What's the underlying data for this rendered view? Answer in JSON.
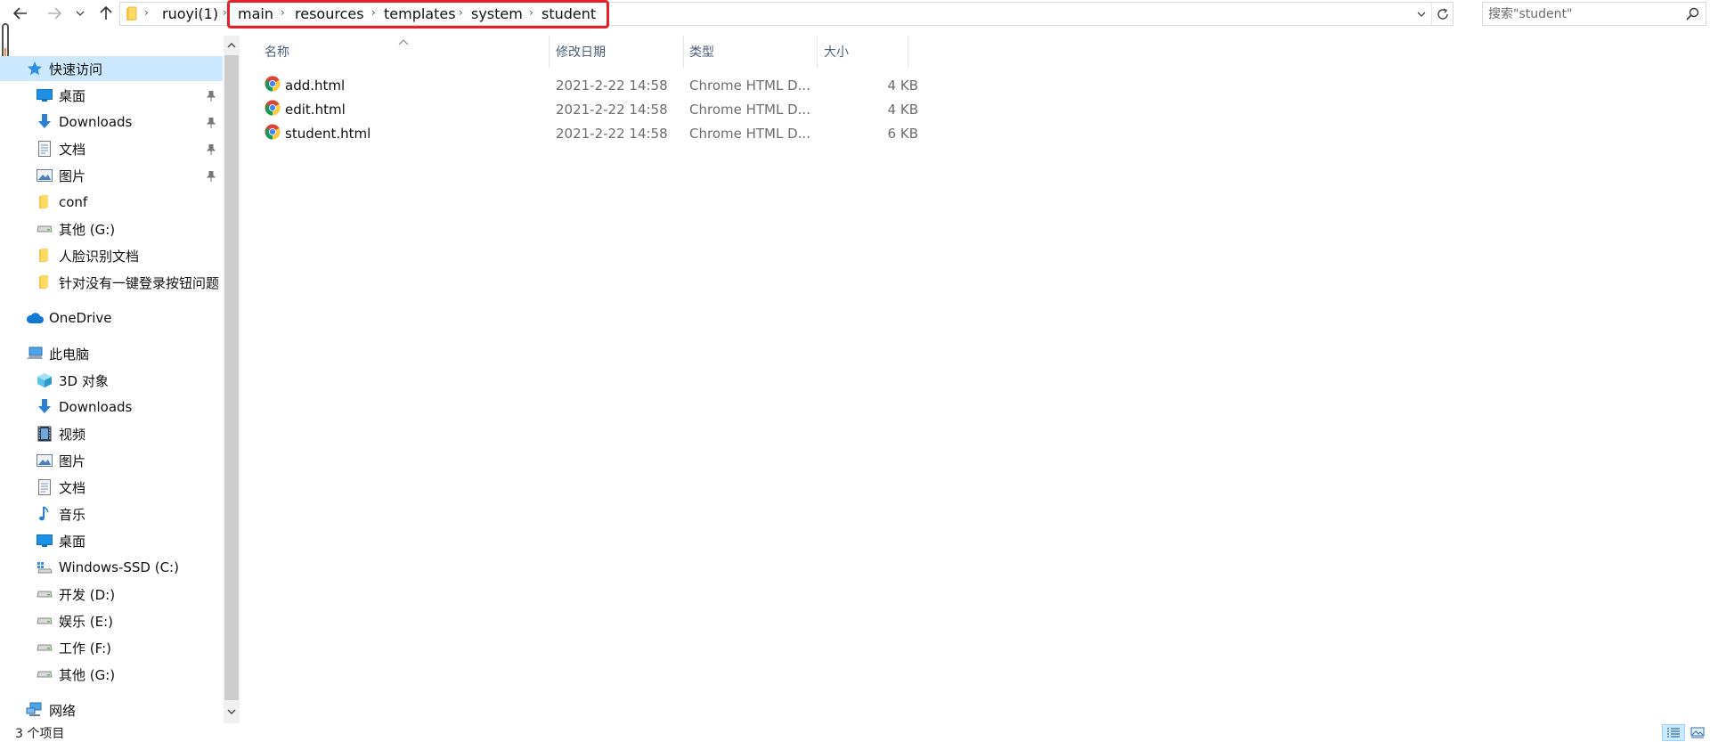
{
  "address_bar": {
    "root_crumb": "ruoyi(1)",
    "crumbs": [
      "main",
      "resources",
      "templates",
      "system",
      "student"
    ]
  },
  "search": {
    "placeholder": "搜索\"student\""
  },
  "nav_pane": {
    "quick_access": {
      "label": "快速访问"
    },
    "quick_items": [
      {
        "label": "桌面",
        "icon": "desktop-icon",
        "pinned": true
      },
      {
        "label": "Downloads",
        "icon": "download-icon",
        "pinned": true
      },
      {
        "label": "文档",
        "icon": "document-icon",
        "pinned": true
      },
      {
        "label": "图片",
        "icon": "picture-icon",
        "pinned": true
      },
      {
        "label": "conf",
        "icon": "folder-icon",
        "pinned": false
      },
      {
        "label": "其他 (G:)",
        "icon": "drive-icon",
        "pinned": false
      },
      {
        "label": "人脸识别文档",
        "icon": "folder-icon",
        "pinned": false
      },
      {
        "label": "针对没有一键登录按钮问题",
        "icon": "folder-icon",
        "pinned": false
      }
    ],
    "onedrive": {
      "label": "OneDrive"
    },
    "this_pc": {
      "label": "此电脑"
    },
    "pc_items": [
      {
        "label": "3D 对象",
        "icon": "3d-objects-icon"
      },
      {
        "label": "Downloads",
        "icon": "download-icon"
      },
      {
        "label": "视频",
        "icon": "video-icon"
      },
      {
        "label": "图片",
        "icon": "picture-icon"
      },
      {
        "label": "文档",
        "icon": "document-icon"
      },
      {
        "label": "音乐",
        "icon": "music-icon"
      },
      {
        "label": "桌面",
        "icon": "desktop-icon"
      },
      {
        "label": "Windows-SSD (C:)",
        "icon": "system-drive-icon"
      },
      {
        "label": "开发 (D:)",
        "icon": "drive-icon"
      },
      {
        "label": "娱乐 (E:)",
        "icon": "drive-icon"
      },
      {
        "label": "工作 (F:)",
        "icon": "drive-icon"
      },
      {
        "label": "其他 (G:)",
        "icon": "drive-icon"
      }
    ],
    "network": {
      "label": "网络"
    }
  },
  "file_list": {
    "columns": {
      "name": "名称",
      "date": "修改日期",
      "type": "类型",
      "size": "大小"
    },
    "rows": [
      {
        "name": "add.html",
        "date": "2021-2-22 14:58",
        "type": "Chrome HTML D...",
        "size": "4 KB",
        "icon": "chrome-icon"
      },
      {
        "name": "edit.html",
        "date": "2021-2-22 14:58",
        "type": "Chrome HTML D...",
        "size": "4 KB",
        "icon": "chrome-icon"
      },
      {
        "name": "student.html",
        "date": "2021-2-22 14:58",
        "type": "Chrome HTML D...",
        "size": "6 KB",
        "icon": "chrome-icon"
      }
    ]
  },
  "status_bar": {
    "item_count": "3 个项目"
  },
  "colors": {
    "selection": "#cce8ff",
    "highlight_border": "#e8202a",
    "header_text": "#4c607a"
  }
}
